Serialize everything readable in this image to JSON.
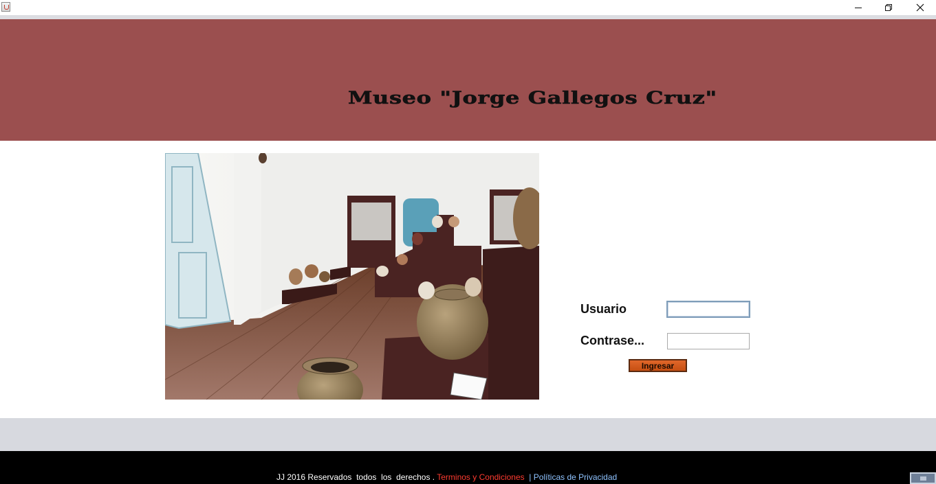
{
  "window": {
    "icon": "java-cup-icon",
    "controls": [
      "minimize-icon",
      "restore-icon",
      "close-icon"
    ]
  },
  "header": {
    "title": "Museo \"Jorge Gallegos Cruz\"",
    "background": "#9b4f4f"
  },
  "photo": {
    "subject": "museum gallery interior with ceramic vessels"
  },
  "login": {
    "username_label": "Usuario",
    "username_value": "",
    "password_label": "Contrase...",
    "password_value": "",
    "submit_label": "Ingresar",
    "submit_color": "#d75a1c"
  },
  "footer": {
    "copyright": "JJ 2016 Reservados  todos  los  derechos . ",
    "terms": "Terminos y Condiciones",
    "separator": "  |",
    "privacy": "Políticas de Privacidad",
    "terms_color": "#ff3b30",
    "privacy_color": "#8fc3ff"
  }
}
